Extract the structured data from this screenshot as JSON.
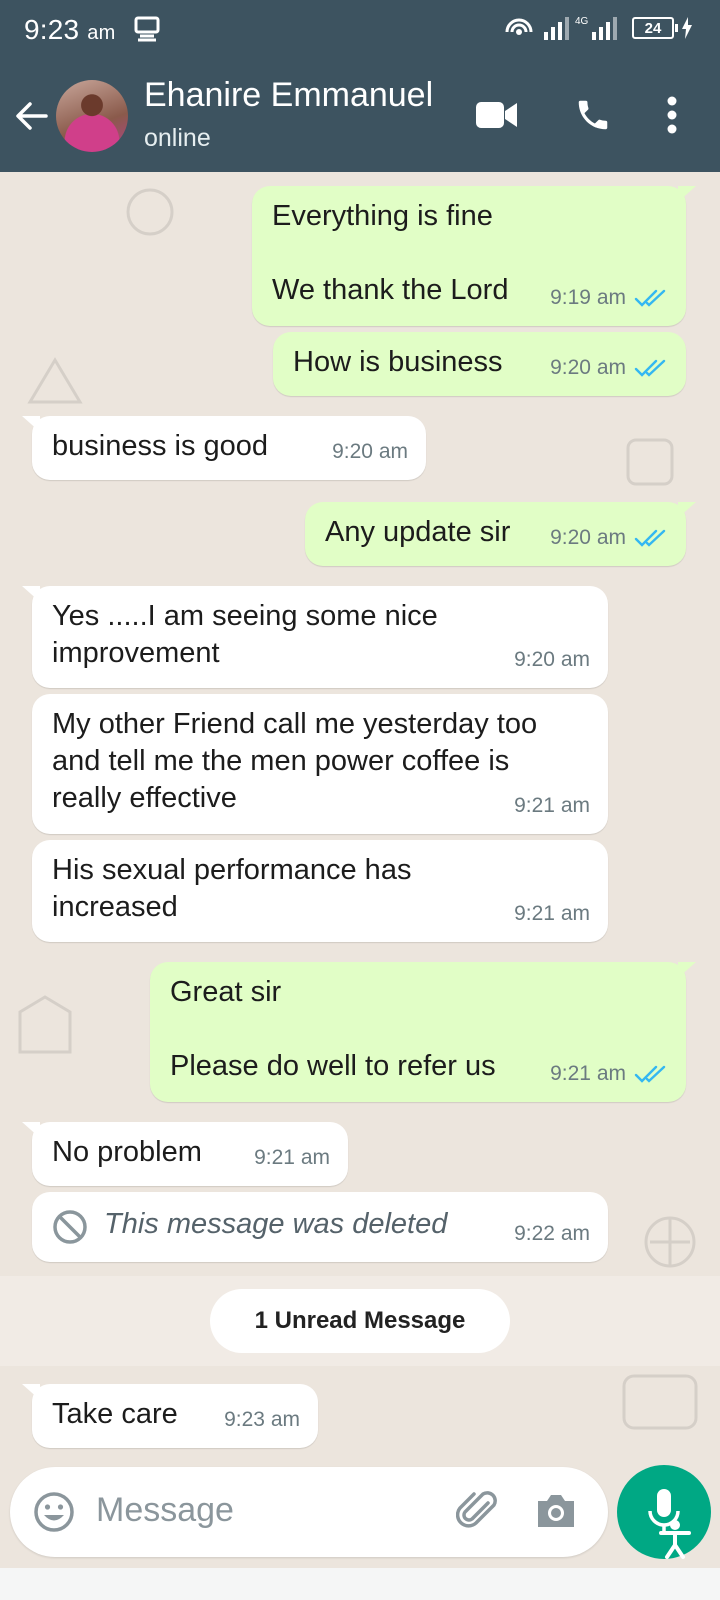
{
  "status_bar": {
    "time": "9:23",
    "ampm": "am",
    "network": "4G",
    "battery": "24"
  },
  "header": {
    "contact_name": "Ehanire Emmanuel",
    "status": "online",
    "icons": [
      "back-arrow-icon",
      "avatar",
      "video-call-icon",
      "phone-icon",
      "more-vert-icon"
    ]
  },
  "messages": [
    {
      "dir": "out",
      "text": "Everything is fine\n\nWe thank the Lord",
      "time": "9:19 am",
      "ticks": "read"
    },
    {
      "dir": "out",
      "text": "How is business",
      "time": "9:20 am",
      "ticks": "read"
    },
    {
      "dir": "in",
      "text": "business is good",
      "time": "9:20 am"
    },
    {
      "dir": "out",
      "text": "Any update sir",
      "time": "9:20 am",
      "ticks": "read"
    },
    {
      "dir": "in",
      "text": "Yes .....I am seeing some nice\nimprovement",
      "time": "9:20 am"
    },
    {
      "dir": "in",
      "text": "My other Friend call me yesterday too\nand tell me the men power coffee is\nreally effective",
      "time": "9:21 am"
    },
    {
      "dir": "in",
      "text": "His sexual performance has\nincreased",
      "time": "9:21 am"
    },
    {
      "dir": "out",
      "text": "Great sir\n\nPlease do well to refer us",
      "time": "9:21 am",
      "ticks": "read"
    },
    {
      "dir": "in",
      "text": "No problem",
      "time": "9:21 am"
    },
    {
      "dir": "in",
      "text": "This message was deleted",
      "time": "9:22 am",
      "deleted": true
    },
    {
      "dir": "in",
      "text": "Take care",
      "time": "9:23 am"
    }
  ],
  "unread_label": "1 Unread Message",
  "composer": {
    "placeholder": "Message"
  },
  "colors": {
    "header": "#3d5360",
    "outgoing": "#e1fec6",
    "incoming": "#ffffff",
    "tick": "#34b7f1",
    "mic": "#00a884"
  }
}
